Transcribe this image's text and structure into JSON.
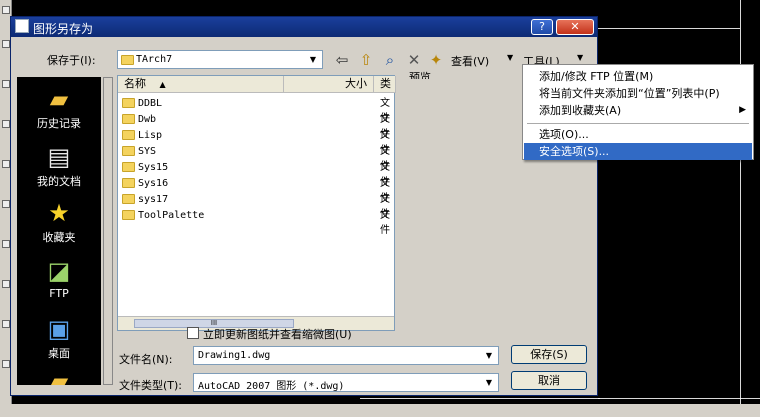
{
  "dialog": {
    "title": "图形另存为",
    "help_btn": "?",
    "close_btn": "✕"
  },
  "savein": {
    "label": "保存于(I):",
    "value": "TArch7"
  },
  "toolbar": {
    "view_label": "查看(V)",
    "tools_label": "工具(L)"
  },
  "places": [
    {
      "label": "历史记录",
      "icon": "history-icon"
    },
    {
      "label": "我的文档",
      "icon": "my-documents-icon"
    },
    {
      "label": "收藏夹",
      "icon": "favorites-icon"
    },
    {
      "label": "FTP",
      "icon": "ftp-icon"
    },
    {
      "label": "桌面",
      "icon": "desktop-icon"
    }
  ],
  "filelist": {
    "columns": [
      "名称",
      "大小",
      "类"
    ],
    "files": [
      {
        "name": "DDBL",
        "type": "文件"
      },
      {
        "name": "Dwb",
        "type": "文件"
      },
      {
        "name": "Lisp",
        "type": "文件"
      },
      {
        "name": "SYS",
        "type": "文件"
      },
      {
        "name": "Sys15",
        "type": "文件"
      },
      {
        "name": "Sys16",
        "type": "文件"
      },
      {
        "name": "sys17",
        "type": "文件"
      },
      {
        "name": "ToolPalette",
        "type": "文件"
      }
    ],
    "hscroll_grip": "III"
  },
  "preview": {
    "label": "预览"
  },
  "thumbnail_checkbox": {
    "label": "立即更新图纸并查看缩微图(U)"
  },
  "filename": {
    "label": "文件名(N):",
    "value": "Drawing1.dwg"
  },
  "filetype": {
    "label": "文件类型(T):",
    "value": "AutoCAD 2007 图形 (*.dwg)"
  },
  "buttons": {
    "save": "保存(S)",
    "cancel": "取消"
  },
  "tools_menu": {
    "items": [
      {
        "label": "添加/修改 FTP 位置(M)",
        "has_submenu": false,
        "selected": false
      },
      {
        "label": "将当前文件夹添加到“位置”列表中(P)",
        "has_submenu": false,
        "selected": false
      },
      {
        "label": "添加到收藏夹(A)",
        "has_submenu": true,
        "selected": false
      },
      {
        "label": "选项(O)...",
        "has_submenu": false,
        "selected": false
      },
      {
        "label": "安全选项(S)...",
        "has_submenu": false,
        "selected": true
      }
    ],
    "submenu_arrow": "▶"
  }
}
